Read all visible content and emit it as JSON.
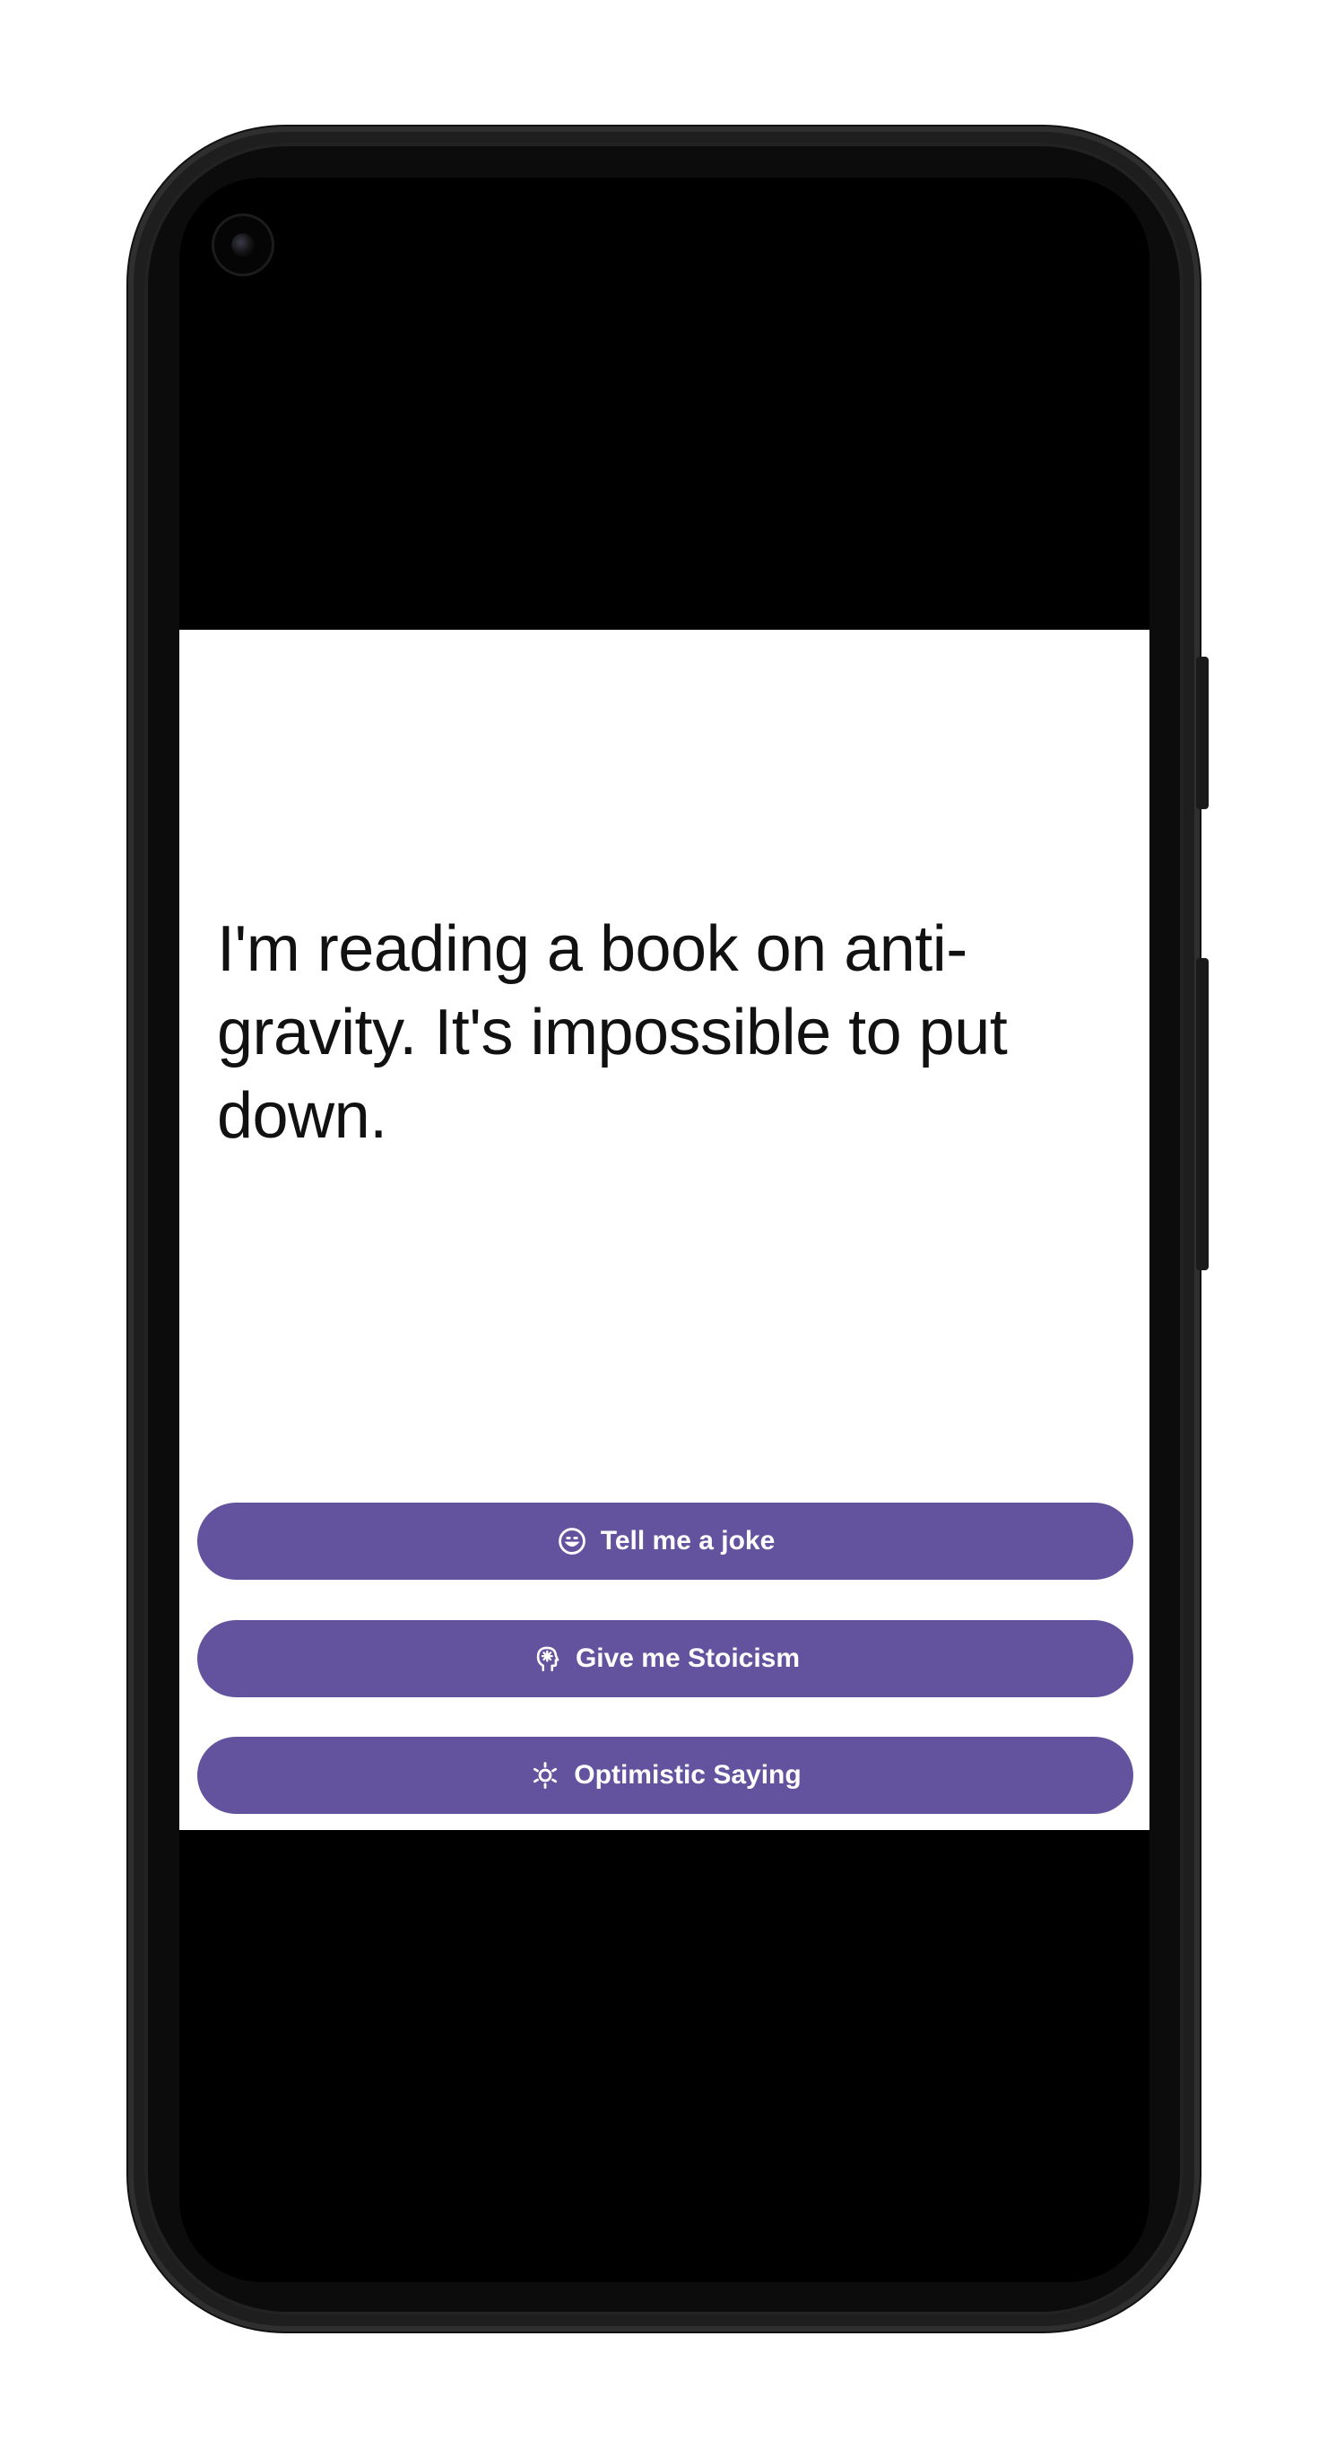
{
  "quote": {
    "text": "I'm reading a book on anti-gravity. It's impossible to put down."
  },
  "buttons": [
    {
      "label": "Tell me a joke",
      "icon": "smiley-icon"
    },
    {
      "label": "Give me Stoicism",
      "icon": "head-gear-icon"
    },
    {
      "label": "Optimistic Saying",
      "icon": "sun-gear-icon"
    }
  ],
  "colors": {
    "button_bg": "#63529e",
    "button_text": "#ffffff",
    "app_bg": "#ffffff",
    "text": "#111111"
  }
}
